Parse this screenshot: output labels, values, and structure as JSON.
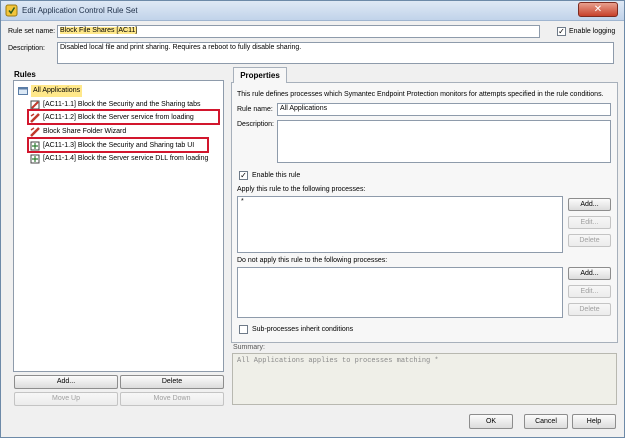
{
  "window": {
    "title": "Edit Application Control Rule Set"
  },
  "header": {
    "rule_set_name_label": "Rule set name:",
    "rule_set_name_value": "Block File Shares [AC11]",
    "enable_logging_label": "Enable logging",
    "enable_logging_checked": true,
    "description_label": "Description:",
    "description_value": "Disabled local file and print sharing.  Requires a reboot to fully disable sharing."
  },
  "rules": {
    "title": "Rules",
    "root": "All Applications",
    "items": [
      {
        "label": "[AC11-1.1] Block the Security and the Sharing tabs",
        "icon": "rule-icon",
        "highlighted": false
      },
      {
        "label": "[AC11-1.2] Block the Server service from loading",
        "icon": "rule-icon",
        "highlighted": true
      },
      {
        "label": "Block Share Folder Wizard",
        "icon": "rule-icon",
        "highlighted": false
      },
      {
        "label": "[AC11-1.3] Block the Security and Sharing tab UI",
        "icon": "rule-icon",
        "highlighted": true
      },
      {
        "label": "[AC11-1.4] Block the Server service DLL from loading",
        "icon": "rule-icon",
        "highlighted": false
      }
    ],
    "add_label": "Add...",
    "delete_label": "Delete",
    "move_up_label": "Move Up",
    "move_down_label": "Move Down"
  },
  "properties": {
    "tab_label": "Properties",
    "info_text": "This rule defines processes which Symantec Endpoint Protection monitors for attempts specified in the rule conditions.",
    "rule_name_label": "Rule name:",
    "rule_name_value": "All Applications",
    "description_label": "Description:",
    "enable_rule_label": "Enable this rule",
    "enable_rule_checked": true,
    "apply_label": "Apply this rule to the following processes:",
    "apply_value": "*",
    "not_apply_label": "Do not apply this rule to the following processes:",
    "add_label": "Add...",
    "edit_label": "Edit...",
    "delete_label": "Delete",
    "subprocess_label": "Sub-processes inherit conditions",
    "subprocess_checked": false
  },
  "summary": {
    "label": "Summary:",
    "text": "All Applications applies to processes matching *"
  },
  "footer": {
    "ok_label": "OK",
    "cancel_label": "Cancel",
    "help_label": "Help"
  }
}
